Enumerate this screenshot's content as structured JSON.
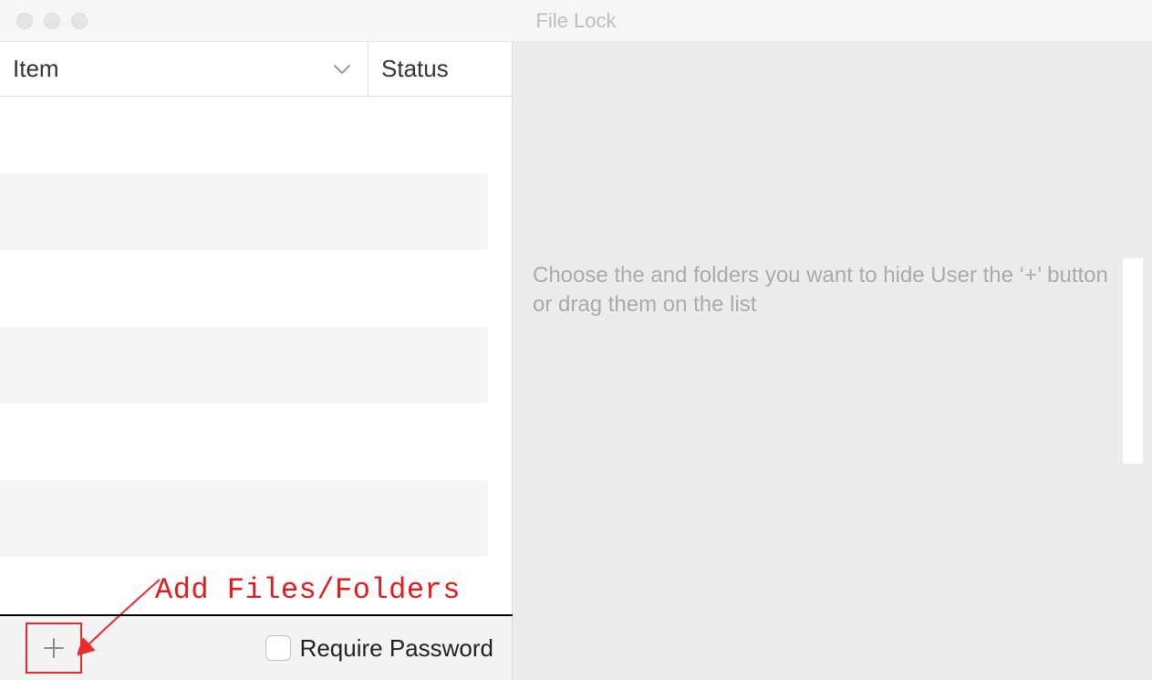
{
  "window": {
    "title": "File Lock"
  },
  "columns": {
    "item_label": "Item",
    "status_label": "Status"
  },
  "footer": {
    "require_password_label": "Require Password"
  },
  "annotation": {
    "label": "Add Files/Folders"
  },
  "right_panel": {
    "hint": "Choose the and folders you want to hide User the ‘+’ button or drag them on the list"
  }
}
